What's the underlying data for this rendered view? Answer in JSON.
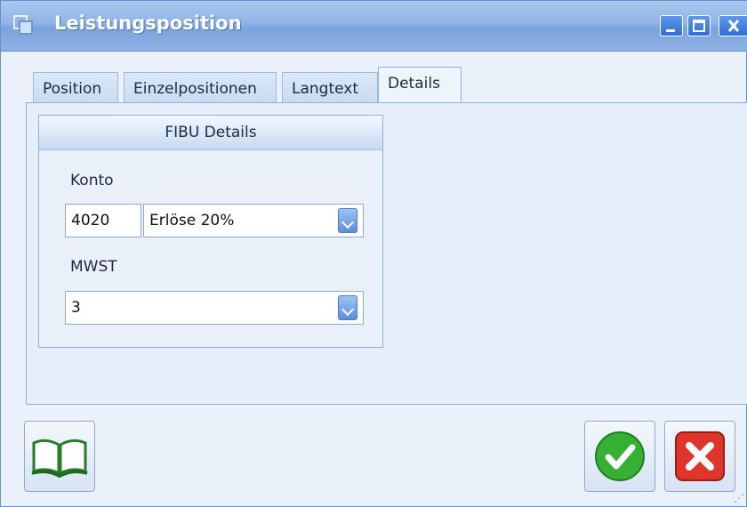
{
  "window": {
    "title": "Leistungsposition"
  },
  "tabs": [
    {
      "label": "Position"
    },
    {
      "label": "Einzelpositionen"
    },
    {
      "label": "Langtext"
    },
    {
      "label": "Details"
    }
  ],
  "fibu": {
    "header": "FIBU Details",
    "konto_label": "Konto",
    "konto_number": "4020",
    "konto_selected": "Erlöse 20%",
    "mwst_label": "MWST",
    "mwst_selected": "3"
  },
  "icons": {
    "book": "book-icon",
    "ok": "check-icon",
    "cancel": "cancel-icon"
  },
  "colors": {
    "accent": "#2f6fd6",
    "ok": "#2aa62a",
    "cancel": "#d92c1f"
  }
}
